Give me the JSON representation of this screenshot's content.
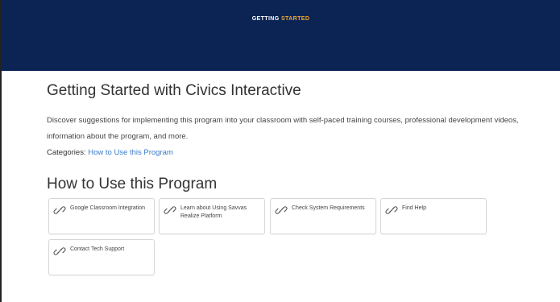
{
  "banner": {
    "title_part1": "GETTING ",
    "title_part2": "STARTED"
  },
  "page": {
    "title": "Getting Started with Civics Interactive",
    "description": "Discover suggestions for implementing this program into your classroom with self-paced training courses, professional development videos, information about the program, and more.",
    "categories_label": "Categories:",
    "category_link": "How to Use this Program"
  },
  "section": {
    "title": "How to Use this Program",
    "cards": [
      {
        "label": "Google Classroom Integration",
        "icon": "link-icon"
      },
      {
        "label": "Learn about Using Savvas Realize Platform",
        "icon": "link-icon"
      },
      {
        "label": "Check System Requirements",
        "icon": "link-icon"
      },
      {
        "label": "Find Help",
        "icon": "link-icon"
      },
      {
        "label": "Contact Tech Support",
        "icon": "link-icon"
      }
    ]
  },
  "colors": {
    "banner_bg": "#0b2454",
    "banner_accent": "#f0a830",
    "link": "#3a7bc8"
  }
}
